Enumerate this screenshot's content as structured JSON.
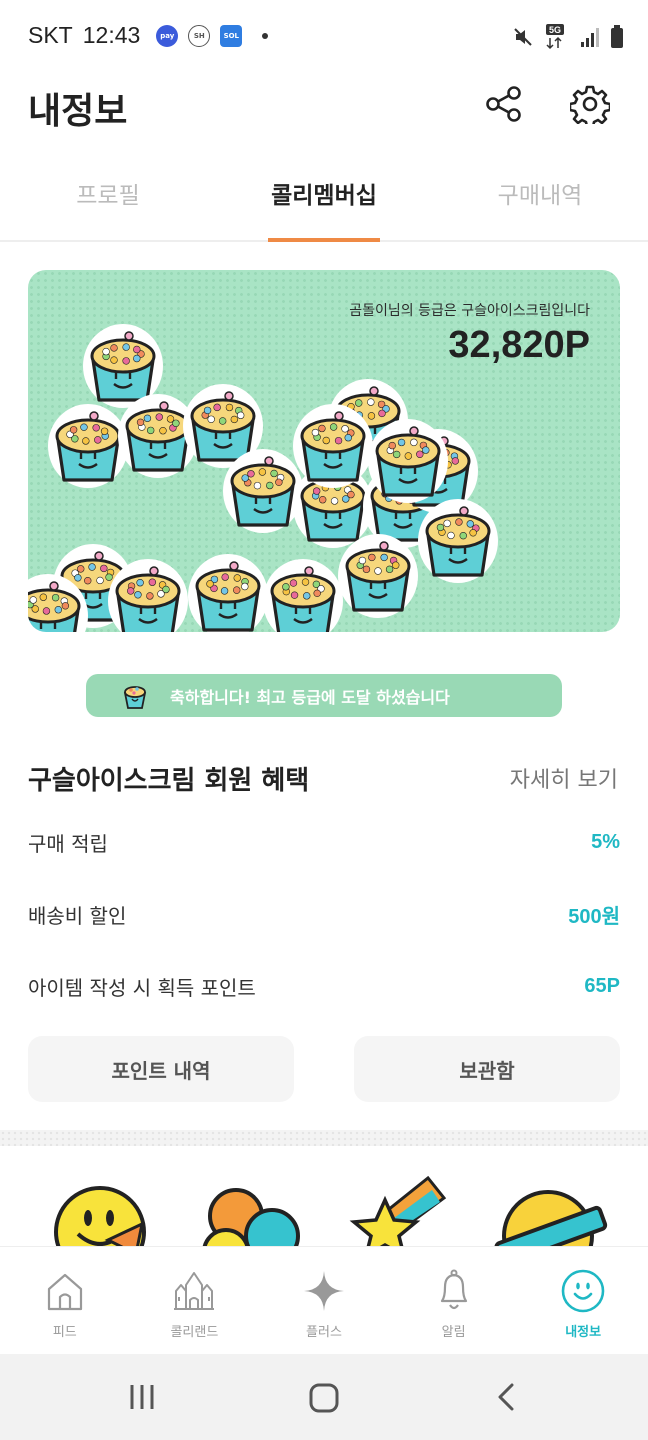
{
  "status_bar": {
    "carrier": "SKT",
    "time": "12:43",
    "badges": [
      "pay",
      "SH",
      "SOL"
    ],
    "network": "5G"
  },
  "header": {
    "title": "내정보",
    "share_icon": "share-icon",
    "settings_icon": "gear-icon"
  },
  "tabs": [
    {
      "label": "프로필",
      "active": false
    },
    {
      "label": "콜리멤버십",
      "active": true
    },
    {
      "label": "구매내역",
      "active": false
    }
  ],
  "card": {
    "grade_text": "곰돌이님의 등급은 구슬아이스크림입니다",
    "points": "32,820P"
  },
  "congrats": {
    "text": "축하합니다! 최고 등급에 도달 하셨습니다"
  },
  "benefits": {
    "title": "구슬아이스크림 회원 혜택",
    "detail_link": "자세히 보기",
    "rows": [
      {
        "label": "구매 적립",
        "value": "5%"
      },
      {
        "label": "배송비 할인",
        "value": "500원"
      },
      {
        "label": "아이템 작성 시 획득 포인트",
        "value": "65P"
      }
    ]
  },
  "buttons": {
    "points_history": "포인트 내역",
    "storage": "보관함"
  },
  "bottom_nav": [
    {
      "label": "피드",
      "icon": "home-icon",
      "active": false
    },
    {
      "label": "콜리랜드",
      "icon": "castle-icon",
      "active": false
    },
    {
      "label": "플러스",
      "icon": "plus-icon",
      "active": false
    },
    {
      "label": "알림",
      "icon": "bell-icon",
      "active": false
    },
    {
      "label": "내정보",
      "icon": "smile-icon",
      "active": true
    }
  ],
  "colors": {
    "accent": "#1fb8c4",
    "tab_indicator": "#ef8a45",
    "card_bg": "#a9e4c5",
    "banner_bg": "#99d9b5"
  }
}
